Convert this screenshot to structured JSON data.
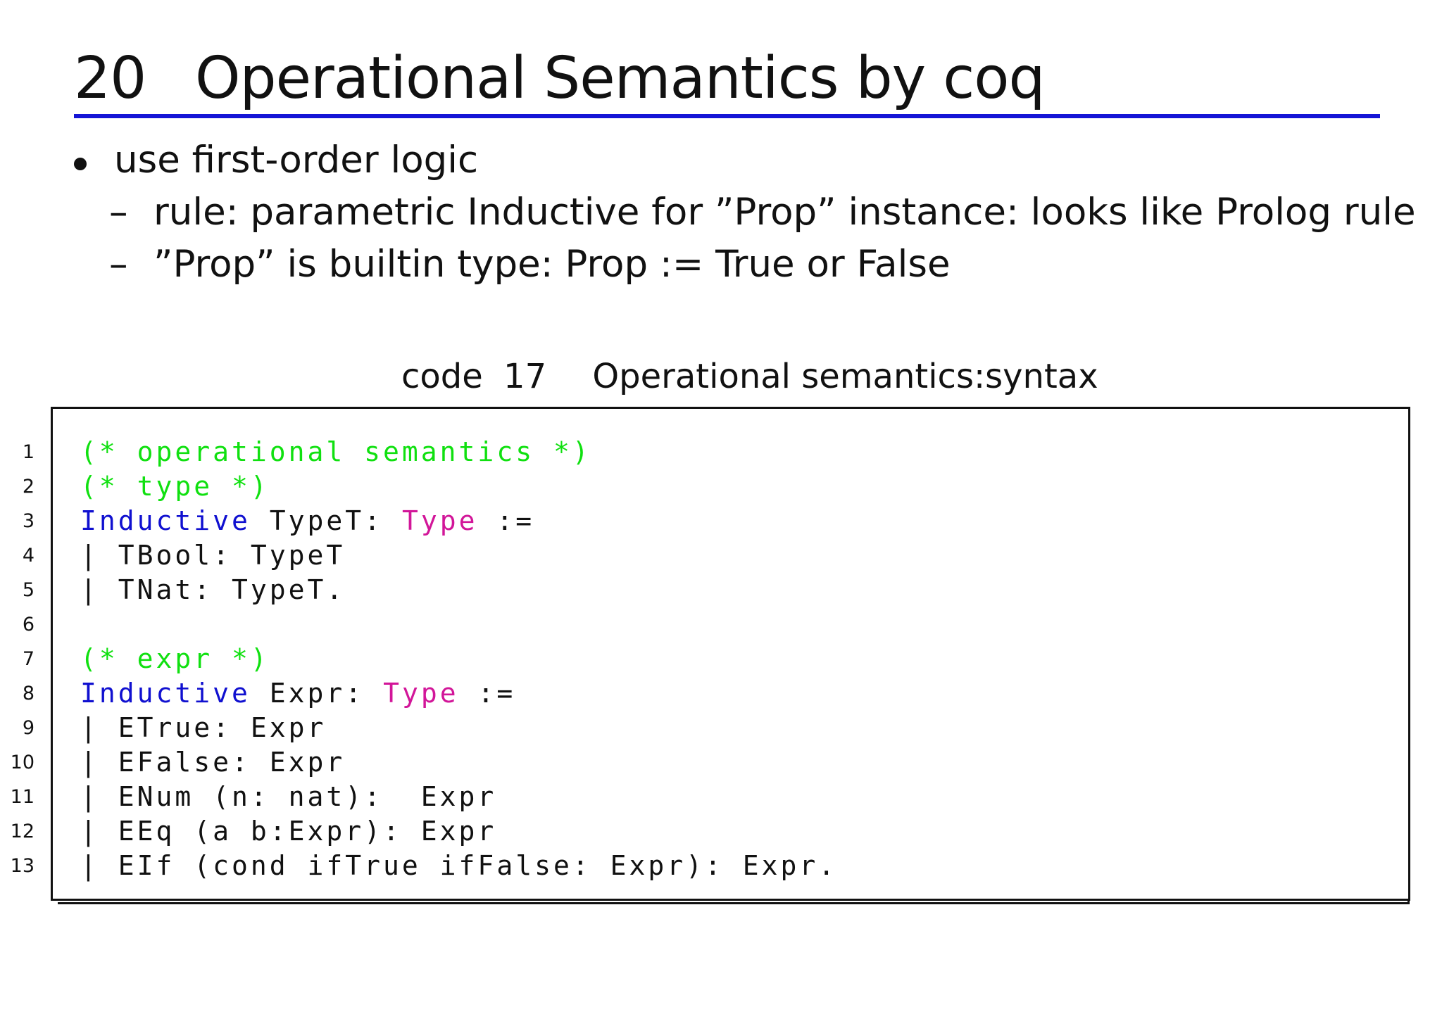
{
  "section": {
    "number": "20",
    "title": "Operational Semantics by coq"
  },
  "bullets": [
    {
      "text": "use first-order logic",
      "subitems": [
        {
          "dash": "–",
          "text": "rule: parametric Inductive for ”Prop” instance: looks like Prolog rule"
        },
        {
          "dash": "–",
          "text": "”Prop” is builtin type: Prop := True or False"
        }
      ]
    }
  ],
  "code_listing": {
    "caption_label": "code",
    "caption_number": "17",
    "caption_title": "Operational semantics:syntax",
    "lines": [
      {
        "number": "1",
        "parts": [
          {
            "text": "(* operational semantics *)",
            "kind": "comment"
          }
        ]
      },
      {
        "number": "2",
        "parts": [
          {
            "text": "(* type *)",
            "kind": "comment"
          }
        ]
      },
      {
        "number": "3",
        "parts": [
          {
            "text": "Inductive",
            "kind": "keyword"
          },
          {
            "text": " TypeT: ",
            "kind": "plain"
          },
          {
            "text": "Type",
            "kind": "type"
          },
          {
            "text": " :=",
            "kind": "plain"
          }
        ]
      },
      {
        "number": "4",
        "parts": [
          {
            "text": "| TBool: TypeT",
            "kind": "plain"
          }
        ]
      },
      {
        "number": "5",
        "parts": [
          {
            "text": "| TNat: TypeT.",
            "kind": "plain"
          }
        ]
      },
      {
        "number": "6",
        "parts": []
      },
      {
        "number": "7",
        "parts": [
          {
            "text": "(* expr *)",
            "kind": "comment"
          }
        ]
      },
      {
        "number": "8",
        "parts": [
          {
            "text": "Inductive",
            "kind": "keyword"
          },
          {
            "text": " Expr: ",
            "kind": "plain"
          },
          {
            "text": "Type",
            "kind": "type"
          },
          {
            "text": " :=",
            "kind": "plain"
          }
        ]
      },
      {
        "number": "9",
        "parts": [
          {
            "text": "| ETrue: Expr",
            "kind": "plain"
          }
        ]
      },
      {
        "number": "10",
        "parts": [
          {
            "text": "| EFalse: Expr",
            "kind": "plain"
          }
        ]
      },
      {
        "number": "11",
        "parts": [
          {
            "text": "| ENum (n: nat):  Expr",
            "kind": "plain"
          }
        ]
      },
      {
        "number": "12",
        "parts": [
          {
            "text": "| EEq (a b:Expr): Expr",
            "kind": "plain"
          }
        ]
      },
      {
        "number": "13",
        "parts": [
          {
            "text": "| EIf (cond ifTrue ifFalse: Expr): Expr.",
            "kind": "plain"
          }
        ]
      }
    ]
  },
  "colors": {
    "heading_rule": "#1515d6",
    "comment": "#10e010",
    "keyword": "#1010d0",
    "type_keyword": "#d21699",
    "text": "#111111"
  }
}
